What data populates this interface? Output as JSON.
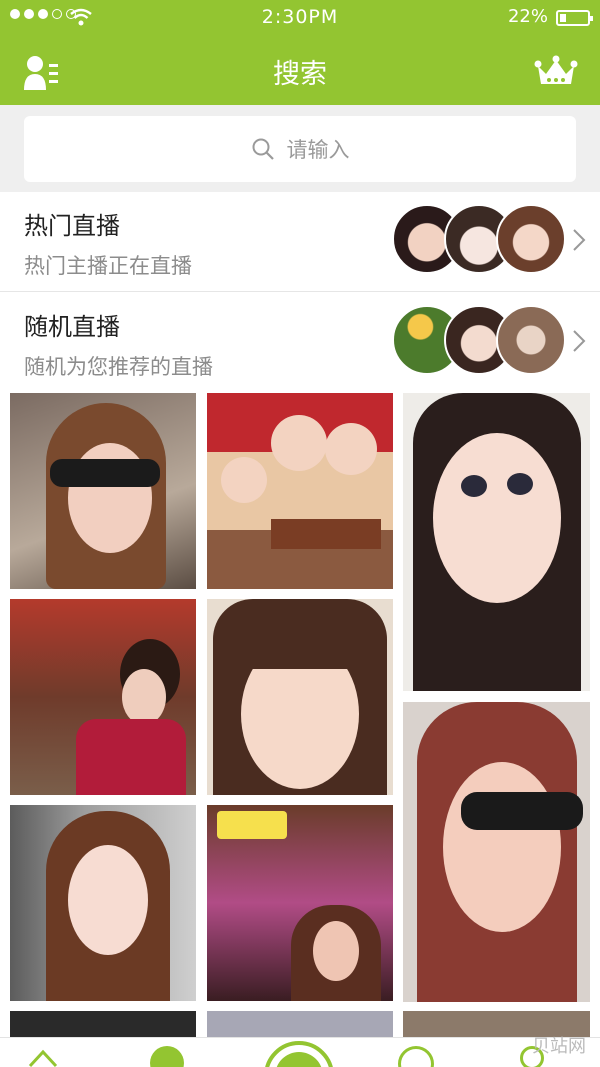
{
  "status_bar": {
    "time": "2:30PM",
    "battery_text": "22%"
  },
  "nav": {
    "title": "搜索",
    "left_icon": "user-list-icon",
    "right_icon": "crown-icon"
  },
  "search": {
    "placeholder": "请输入",
    "icon": "search-icon"
  },
  "live_sections": [
    {
      "title": "热门直播",
      "subtitle": "热门主播正在直播"
    },
    {
      "title": "随机直播",
      "subtitle": "随机为您推荐的直播"
    }
  ],
  "watermark": "贝站网",
  "colors": {
    "brand_green": "#93c531",
    "search_bg": "#efefef"
  }
}
